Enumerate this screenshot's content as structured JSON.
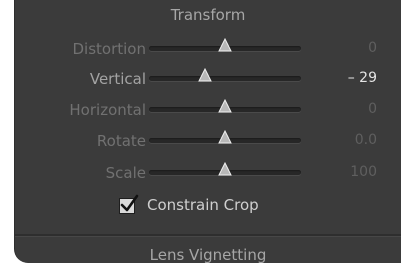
{
  "panel": {
    "transform_title": "Transform",
    "next_section_title": "Lens Vignetting",
    "sliders": [
      {
        "label": "Distortion",
        "value": "0",
        "position": 0.5,
        "active": false
      },
      {
        "label": "Vertical",
        "value": "– 29",
        "position": 0.37,
        "active": true
      },
      {
        "label": "Horizontal",
        "value": "0",
        "position": 0.5,
        "active": false
      },
      {
        "label": "Rotate",
        "value": "0.0",
        "position": 0.5,
        "active": false
      },
      {
        "label": "Scale",
        "value": "100",
        "position": 0.5,
        "active": false
      }
    ],
    "constrain_crop": {
      "label": "Constrain Crop",
      "checked": true
    }
  },
  "colors": {
    "panel_background": "#3b3b3b",
    "active_text": "#e4e4e4",
    "dim_text": "#717171"
  },
  "icons": {
    "slider_thumb": "triangle-thumb-icon",
    "check": "checkmark-icon"
  }
}
